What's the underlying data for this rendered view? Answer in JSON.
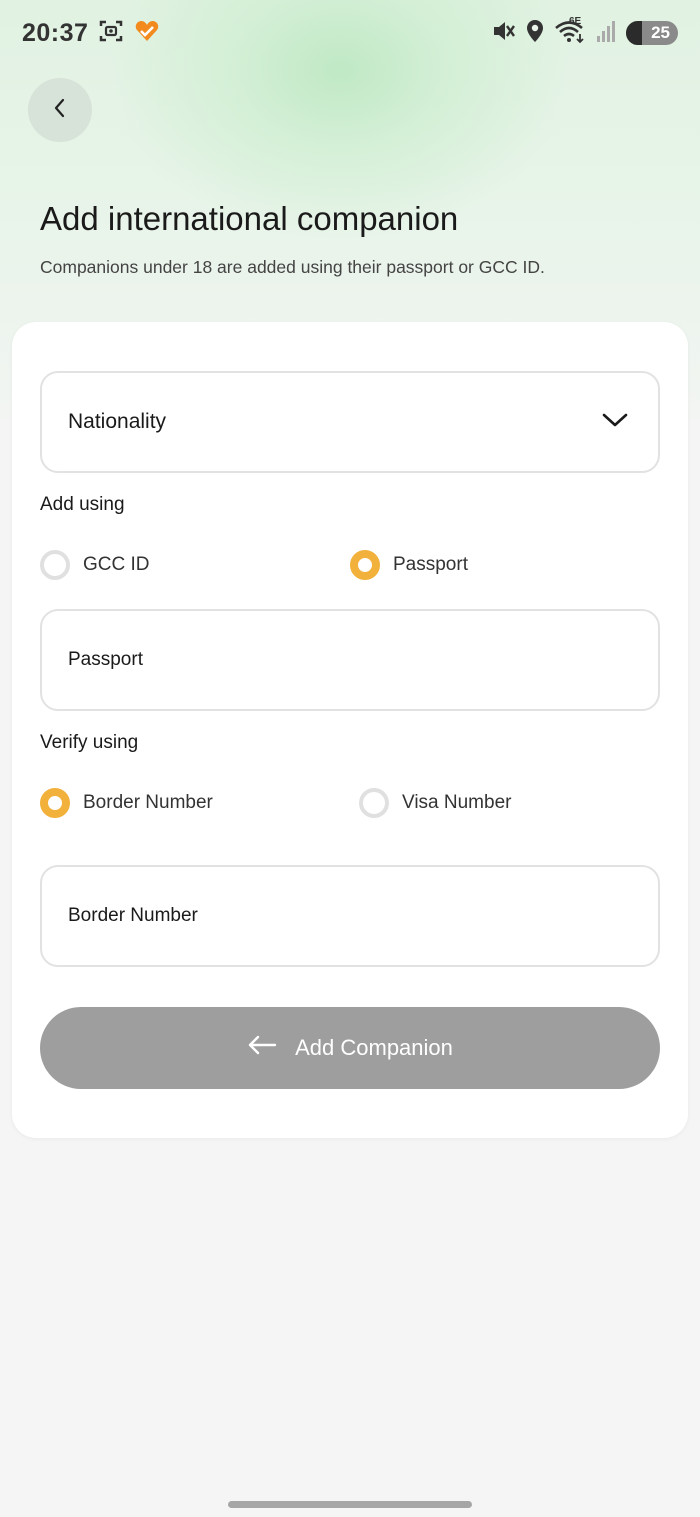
{
  "status_bar": {
    "time": "20:37",
    "network": "6E",
    "battery": "25",
    "icons": [
      "screenshot-icon",
      "health-app-icon",
      "mute-icon",
      "location-icon",
      "wifi-icon",
      "signal-icon",
      "battery-icon"
    ]
  },
  "header": {
    "back_icon": "chevron-left-icon",
    "title": "Add international companion",
    "subtitle": "Companions under 18 are added using their passport or GCC ID."
  },
  "form": {
    "nationality": {
      "label": "Nationality",
      "icon": "chevron-down-icon"
    },
    "add_using": {
      "label": "Add using",
      "options": [
        {
          "label": "GCC ID",
          "selected": false
        },
        {
          "label": "Passport",
          "selected": true
        }
      ]
    },
    "passport_field": {
      "placeholder": "Passport"
    },
    "verify_using": {
      "label": "Verify using",
      "options": [
        {
          "label": "Border Number",
          "selected": true
        },
        {
          "label": "Visa Number",
          "selected": false
        }
      ]
    },
    "border_field": {
      "placeholder": "Border Number"
    },
    "submit": {
      "label": "Add Companion",
      "icon": "arrow-left-icon"
    }
  },
  "colors": {
    "accent": "#f2b13a",
    "button_disabled": "#9e9e9e",
    "radio_off": "#e0e0e0"
  }
}
